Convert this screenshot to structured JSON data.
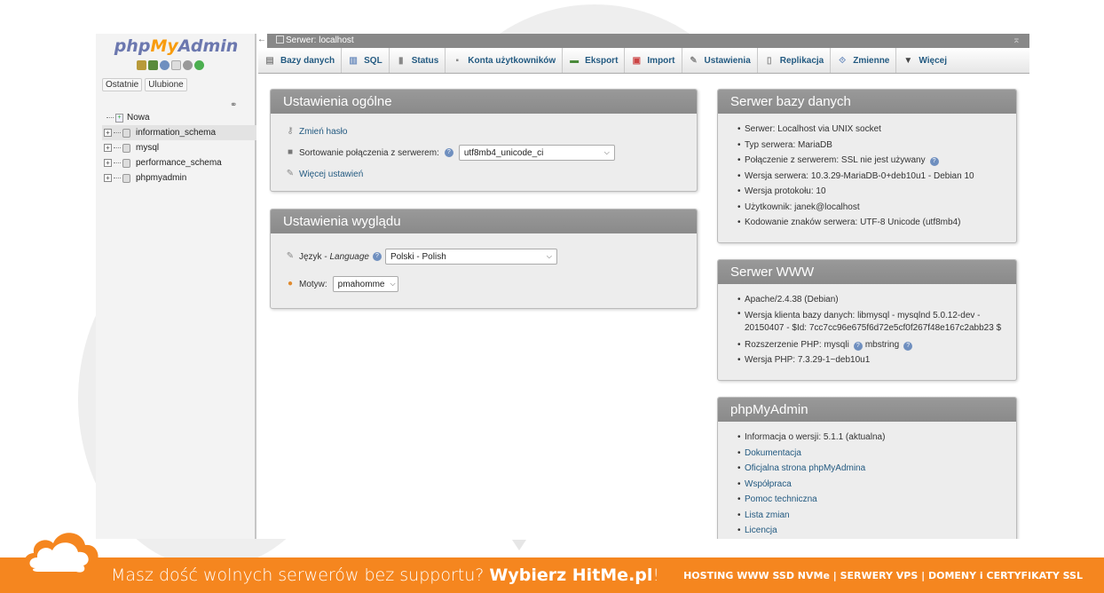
{
  "sidebar": {
    "logo_php": "php",
    "logo_my": "My",
    "logo_admin": "Admin",
    "tabs": [
      "Ostatnie",
      "Ulubione"
    ],
    "tree": [
      {
        "label": "Nowa"
      },
      {
        "label": "information_schema"
      },
      {
        "label": "mysql"
      },
      {
        "label": "performance_schema"
      },
      {
        "label": "phpmyadmin"
      }
    ]
  },
  "topbar": {
    "server": "Serwer: localhost"
  },
  "menu": [
    {
      "label": "Bazy danych",
      "icon": "database-icon"
    },
    {
      "label": "SQL",
      "icon": "sql-icon"
    },
    {
      "label": "Status",
      "icon": "status-icon"
    },
    {
      "label": "Konta użytkowników",
      "icon": "users-icon"
    },
    {
      "label": "Eksport",
      "icon": "export-icon"
    },
    {
      "label": "Import",
      "icon": "import-icon"
    },
    {
      "label": "Ustawienia",
      "icon": "wrench-icon"
    },
    {
      "label": "Replikacja",
      "icon": "replication-icon"
    },
    {
      "label": "Zmienne",
      "icon": "variables-icon"
    },
    {
      "label": "Więcej",
      "icon": "chevron-down-icon"
    }
  ],
  "general": {
    "title": "Ustawienia ogólne",
    "change_password": "Zmień hasło",
    "collation_label": "Sortowanie połączenia z serwerem:",
    "collation_value": "utf8mb4_unicode_ci",
    "more_settings": "Więcej ustawień"
  },
  "appearance": {
    "title": "Ustawienia wyglądu",
    "language_label_pl": "Język - ",
    "language_label_en": "Language",
    "language_value": "Polski - Polish",
    "theme_label": "Motyw:",
    "theme_value": "pmahomme"
  },
  "db_server": {
    "title": "Serwer bazy danych",
    "items": [
      "Serwer: Localhost via UNIX socket",
      "Typ serwera: MariaDB",
      "Połączenie z serwerem: SSL nie jest używany",
      "Wersja serwera: 10.3.29-MariaDB-0+deb10u1 - Debian 10",
      "Wersja protokołu: 10",
      "Użytkownik: janek@localhost",
      "Kodowanie znaków serwera: UTF-8 Unicode (utf8mb4)"
    ]
  },
  "web_server": {
    "title": "Serwer WWW",
    "items": [
      "Apache/2.4.38 (Debian)",
      "Wersja klienta bazy danych: libmysql - mysqlnd 5.0.12-dev - 20150407 - $Id: 7cc7cc96e675f6d72e5cf0f267f48e167c2abb23 $",
      "Rozszerzenie PHP: mysqli",
      "mbstring",
      "Wersja PHP: 7.3.29-1~deb10u1"
    ]
  },
  "pma": {
    "title": "phpMyAdmin",
    "version": "Informacja o wersji: 5.1.1 (aktualna)",
    "links": [
      "Dokumentacja",
      "Oficjalna strona phpMyAdmina",
      "Współpraca",
      "Pomoc techniczna",
      "Lista zmian",
      "Licencja"
    ]
  },
  "banner": {
    "slogan": "Masz dość wolnych serwerów bez supportu? ",
    "slogan_bold": "Wybierz HitMe.pl",
    "slogan_end": "!",
    "offers": "HOSTING WWW SSD NVMe | SERWERY VPS | DOMENY i CERTYFIKATY SSL",
    "color": "#f5861f"
  }
}
